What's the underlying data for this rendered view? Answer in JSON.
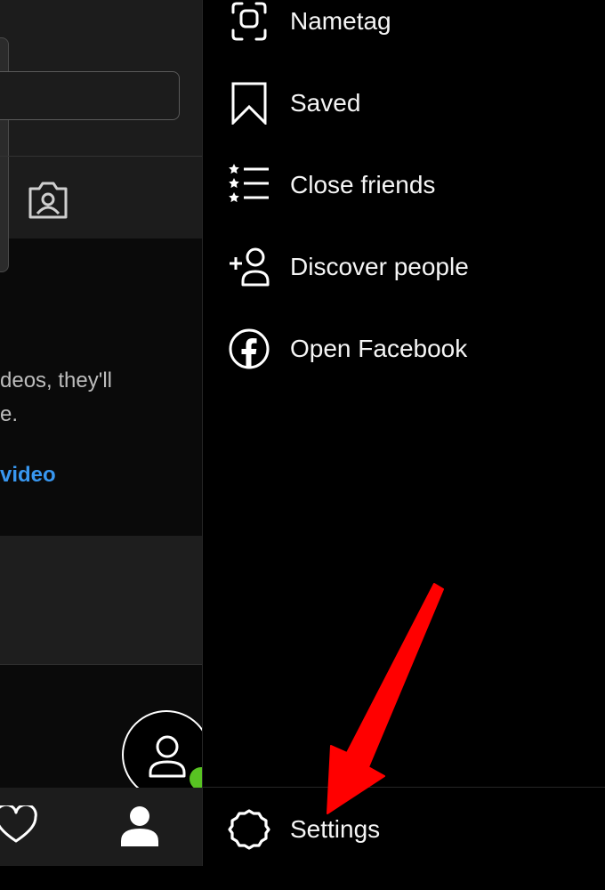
{
  "left_pane": {
    "empty_text_line1": "deos, they'll",
    "empty_text_line2": "e.",
    "share_link": "video"
  },
  "menu": {
    "items": [
      {
        "label": "Nametag",
        "icon": "nametag-icon"
      },
      {
        "label": "Saved",
        "icon": "bookmark-icon"
      },
      {
        "label": "Close friends",
        "icon": "close-friends-icon"
      },
      {
        "label": "Discover people",
        "icon": "add-person-icon"
      },
      {
        "label": "Open Facebook",
        "icon": "facebook-icon"
      }
    ],
    "settings": {
      "label": "Settings",
      "icon": "gear-icon"
    }
  },
  "colors": {
    "background": "#000000",
    "link_blue": "#3897f0",
    "online_green": "#58c322",
    "annotation_red": "#ff0000"
  }
}
